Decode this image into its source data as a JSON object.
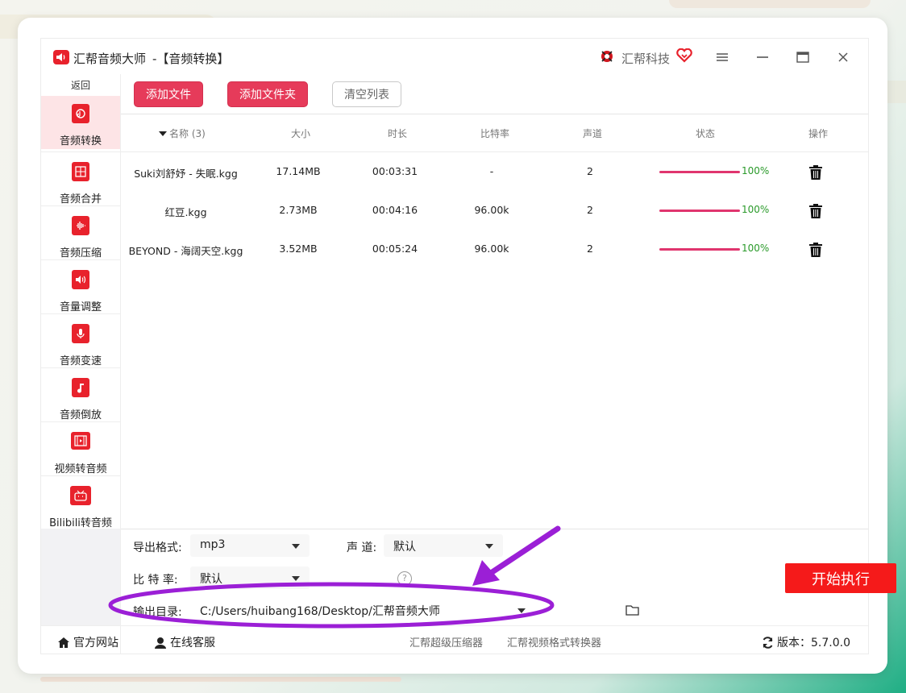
{
  "window": {
    "app_name": "汇帮音频大师",
    "subtitle": "-【音频转换】",
    "brand": "汇帮科技"
  },
  "sidebar": {
    "back": "返回",
    "items": [
      {
        "label": "音频转换",
        "icon": "audio-convert-icon",
        "active": true
      },
      {
        "label": "音频合并",
        "icon": "audio-merge-icon"
      },
      {
        "label": "音频压缩",
        "icon": "audio-compress-icon"
      },
      {
        "label": "音量调整",
        "icon": "volume-icon"
      },
      {
        "label": "音频变速",
        "icon": "microphone-icon"
      },
      {
        "label": "音频倒放",
        "icon": "music-note-icon"
      },
      {
        "label": "视频转音频",
        "icon": "film-icon"
      },
      {
        "label": "Bilibili转音频",
        "icon": "tv-icon"
      }
    ]
  },
  "toolbar": {
    "add_file": "添加文件",
    "add_folder": "添加文件夹",
    "clear_list": "清空列表"
  },
  "table": {
    "headers": {
      "name": "名称 (3)",
      "size": "大小",
      "duration": "时长",
      "bitrate": "比特率",
      "channels": "声道",
      "status": "状态",
      "actions": "操作"
    },
    "rows": [
      {
        "name": "Suki刘舒妤 - 失眠.kgg",
        "size": "17.14MB",
        "duration": "00:03:31",
        "bitrate": "-",
        "channels": "2",
        "progress": "100%"
      },
      {
        "name": "红豆.kgg",
        "size": "2.73MB",
        "duration": "00:04:16",
        "bitrate": "96.00k",
        "channels": "2",
        "progress": "100%"
      },
      {
        "name": "BEYOND - 海阔天空.kgg",
        "size": "3.52MB",
        "duration": "00:05:24",
        "bitrate": "96.00k",
        "channels": "2",
        "progress": "100%"
      }
    ]
  },
  "settings": {
    "format_label": "导出格式:",
    "format_value": "mp3",
    "channel_label": "声 道:",
    "channel_value": "默认",
    "bitrate_label": "比 特 率:",
    "bitrate_value": "默认",
    "help": "?",
    "output_label": "输出目录:",
    "output_value": "C:/Users/huibang168/Desktop/汇帮音频大师",
    "start": "开始执行"
  },
  "footer": {
    "website": "官方网站",
    "support": "在线客服",
    "compressor": "汇帮超级压缩器",
    "video_converter": "汇帮视频格式转换器",
    "version": "版本：5.7.0.0"
  },
  "colors": {
    "accent": "#e63b5a",
    "brand_red": "#e8222c",
    "start_button": "#f51a1a",
    "progress": "#e0356e",
    "annotation": "#9b1fd6"
  }
}
